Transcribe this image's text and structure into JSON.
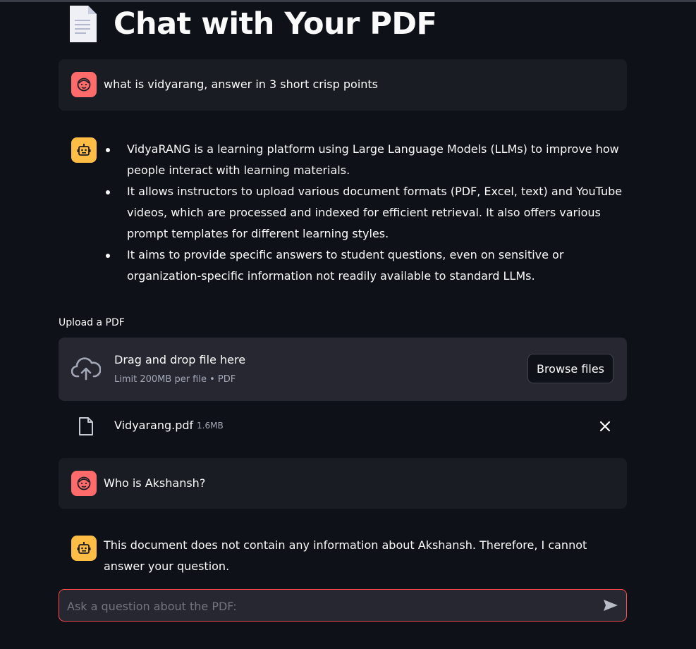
{
  "app": {
    "title": "Chat with Your PDF",
    "title_icon": "page-document-icon"
  },
  "messages": [
    {
      "role": "user",
      "avatar_icon": "user-face-icon",
      "text": "what is vidyarang, answer in 3 short crisp points"
    },
    {
      "role": "assistant",
      "avatar_icon": "robot-icon",
      "points": [
        "VidyaRANG is a learning platform using Large Language Models (LLMs) to improve how people interact with learning materials.",
        "It allows instructors to upload various document formats (PDF, Excel, text) and YouTube videos, which are processed and indexed for efficient retrieval. It also offers various prompt templates for different learning styles.",
        "It aims to provide specific answers to student questions, even on sensitive or organization-specific information not readily available to standard LLMs."
      ]
    },
    {
      "role": "user",
      "avatar_icon": "user-face-icon",
      "text": "Who is Akshansh?"
    },
    {
      "role": "assistant",
      "avatar_icon": "robot-icon",
      "text": "This document does not contain any information about Akshansh. Therefore, I cannot answer your question."
    }
  ],
  "uploader": {
    "label": "Upload a PDF",
    "drop_title": "Drag and drop file here",
    "drop_subtitle": "Limit 200MB per file • PDF",
    "browse_label": "Browse files",
    "icon": "cloud-upload-icon"
  },
  "uploaded_file": {
    "name": "Vidyarang.pdf",
    "size": "1.6MB",
    "icon": "file-icon",
    "remove_icon": "close-icon"
  },
  "chat_input": {
    "placeholder": "Ask a question about the PDF:",
    "send_icon": "send-icon"
  },
  "colors": {
    "background": "#0e1117",
    "user_bubble": "#1a1c24",
    "user_avatar": "#ff6b6b",
    "bot_avatar": "#ffbd45",
    "input_border": "#ff4b4b",
    "dropzone": "#262730"
  }
}
